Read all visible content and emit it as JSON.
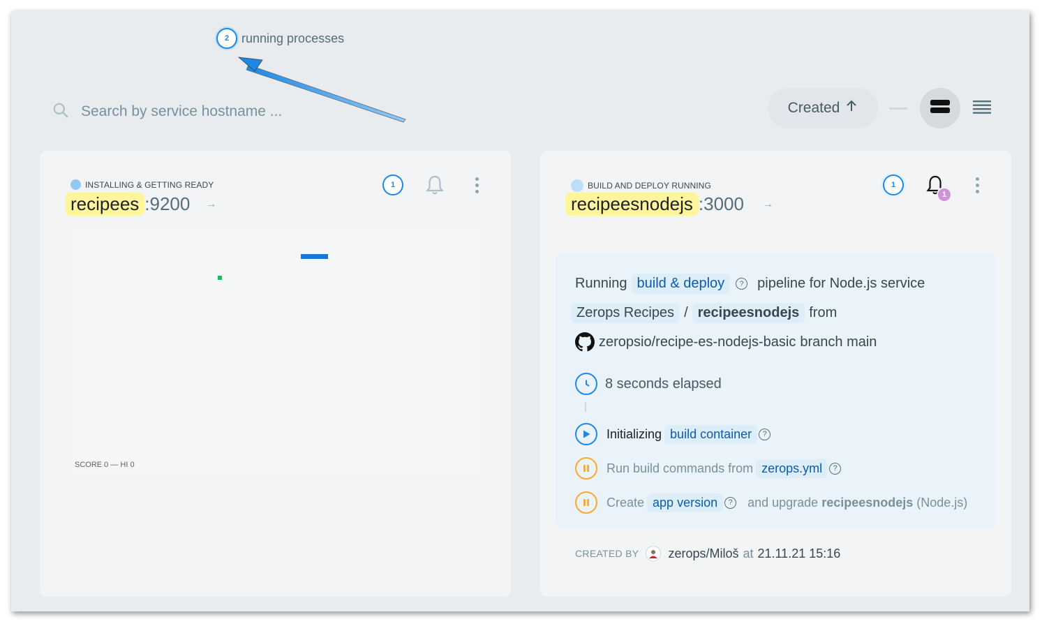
{
  "annotation": {
    "count": "2",
    "label": "running processes"
  },
  "search": {
    "placeholder": "Search by service hostname ..."
  },
  "sort": {
    "label": "Created"
  },
  "services": [
    {
      "status": "INSTALLING & GETTING READY",
      "hostname": "recipees",
      "port": ":9200",
      "processes": "1",
      "game": {
        "score_text": "SCORE 0 — HI 0"
      }
    },
    {
      "status": "BUILD AND DEPLOY RUNNING",
      "hostname": "recipeesnodejs",
      "port": ":3000",
      "processes": "1",
      "notifications": "1",
      "pipeline": {
        "running": "Running",
        "build_deploy": "build & deploy",
        "for_text": "pipeline for Node.js service",
        "project": "Zerops Recipes",
        "slash": "/",
        "service": "recipeesnodejs",
        "from": "from",
        "repo": "zeropsio/recipe-es-nodejs-basic",
        "branch_text": "branch main",
        "elapsed": "8 seconds elapsed",
        "step1_text": "Initializing",
        "step1_link": "build container",
        "step2_text": "Run build commands from",
        "step2_link": "zerops.yml",
        "step3_text": "Create",
        "step3_link": "app version",
        "step3_and": "and upgrade",
        "step3_service": "recipeesnodejs",
        "step3_type": "(Node.js)"
      },
      "created_by": {
        "label": "CREATED BY",
        "user": "zerops/Miloš",
        "at": "at",
        "date": "21.11.21 15:16"
      }
    }
  ],
  "colors": {
    "accent": "#1e88e5",
    "highlight": "#fff59d",
    "pending": "#ffa726",
    "badge": "#ce93d8"
  }
}
